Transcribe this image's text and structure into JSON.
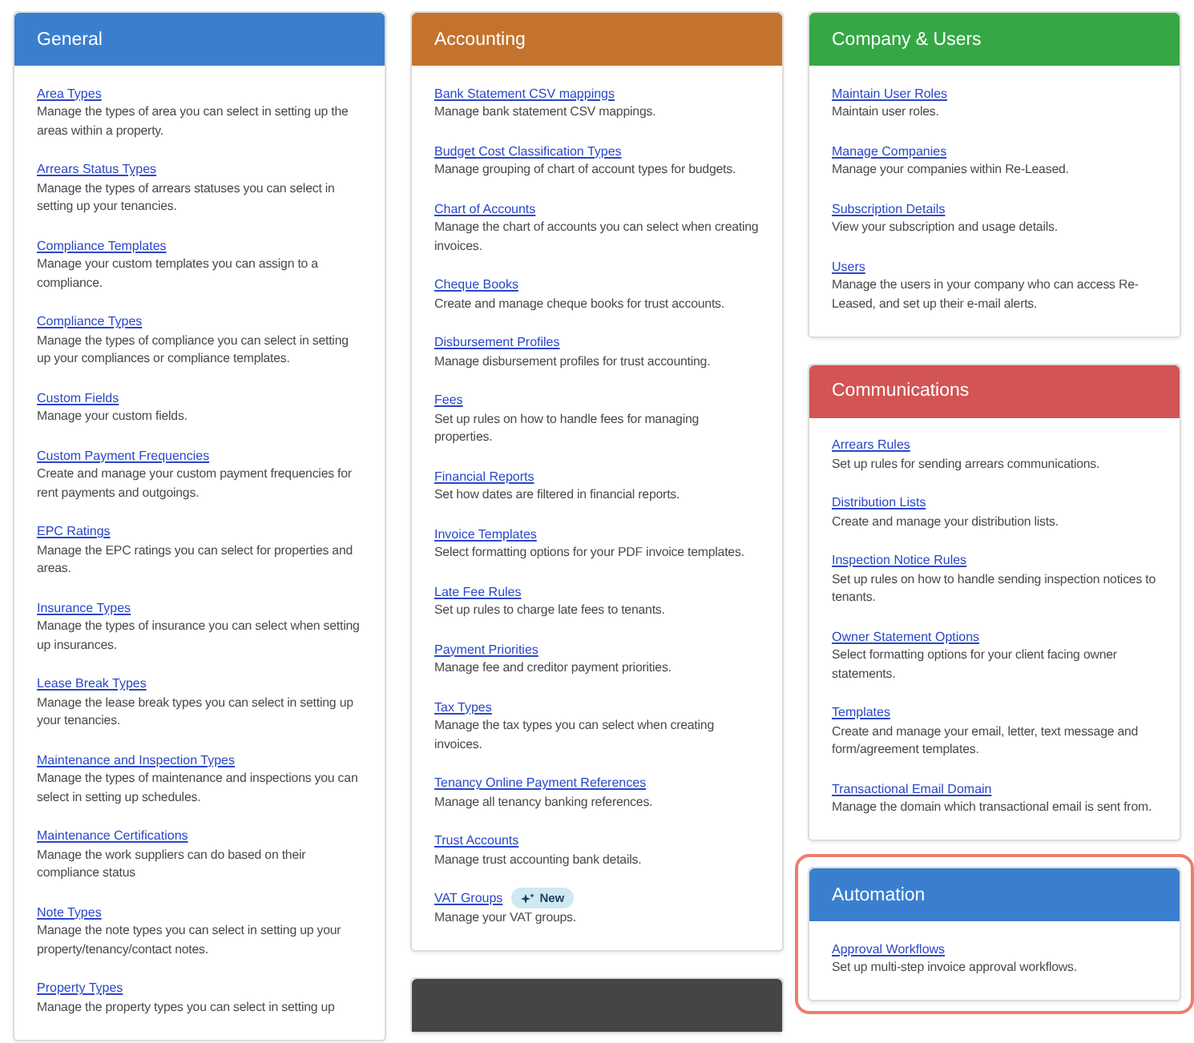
{
  "columns": [
    {
      "panels": [
        {
          "title": "General",
          "color": "#3a7fcf",
          "highlighted": false,
          "items": [
            {
              "link": "Area Types",
              "description": "Manage the types of area you can select in setting up the areas within a property."
            },
            {
              "link": "Arrears Status Types",
              "description": "Manage the types of arrears statuses you can select in setting up your tenancies."
            },
            {
              "link": "Compliance Templates",
              "description": "Manage your custom templates you can assign to a compliance."
            },
            {
              "link": "Compliance Types",
              "description": "Manage the types of compliance you can select in setting up your compliances or compliance templates."
            },
            {
              "link": "Custom Fields",
              "description": "Manage your custom fields."
            },
            {
              "link": "Custom Payment Frequencies",
              "description": "Create and manage your custom payment frequencies for rent payments and outgoings."
            },
            {
              "link": "EPC Ratings",
              "description": "Manage the EPC ratings you can select for properties and areas."
            },
            {
              "link": "Insurance Types",
              "description": "Manage the types of insurance you can select when setting up insurances."
            },
            {
              "link": "Lease Break Types",
              "description": "Manage the lease break types you can select in setting up your tenancies."
            },
            {
              "link": "Maintenance and Inspection Types",
              "description": "Manage the types of maintenance and inspections you can select in setting up schedules."
            },
            {
              "link": "Maintenance Certifications",
              "description": "Manage the work suppliers can do based on their compliance status"
            },
            {
              "link": "Note Types",
              "description": "Manage the note types you can select in setting up your property/tenancy/contact notes."
            },
            {
              "link": "Property Types",
              "description": "Manage the property types you can select in setting up"
            }
          ]
        }
      ]
    },
    {
      "panels": [
        {
          "title": "Accounting",
          "color": "#c4732e",
          "highlighted": false,
          "items": [
            {
              "link": "Bank Statement CSV mappings",
              "description": "Manage bank statement CSV mappings."
            },
            {
              "link": "Budget Cost Classification Types",
              "description": "Manage grouping of chart of account types for budgets."
            },
            {
              "link": "Chart of Accounts",
              "description": "Manage the chart of accounts you can select when creating invoices."
            },
            {
              "link": "Cheque Books",
              "description": "Create and manage cheque books for trust accounts."
            },
            {
              "link": "Disbursement Profiles",
              "description": "Manage disbursement profiles for trust accounting."
            },
            {
              "link": "Fees",
              "description": "Set up rules on how to handle fees for managing properties."
            },
            {
              "link": "Financial Reports",
              "description": "Set how dates are filtered in financial reports."
            },
            {
              "link": "Invoice Templates",
              "description": "Select formatting options for your PDF invoice templates."
            },
            {
              "link": "Late Fee Rules",
              "description": "Set up rules to charge late fees to tenants."
            },
            {
              "link": "Payment Priorities",
              "description": "Manage fee and creditor payment priorities."
            },
            {
              "link": "Tax Types",
              "description": "Manage the tax types you can select when creating invoices."
            },
            {
              "link": "Tenancy Online Payment References",
              "description": "Manage all tenancy banking references."
            },
            {
              "link": "Trust Accounts",
              "description": "Manage trust accounting bank details."
            },
            {
              "link": "VAT Groups",
              "badge": "New",
              "description": "Manage your VAT groups."
            }
          ]
        },
        {
          "color": "#454545",
          "highlighted": false
        }
      ]
    },
    {
      "panels": [
        {
          "title": "Company & Users",
          "color": "#35a845",
          "highlighted": false,
          "items": [
            {
              "link": "Maintain User Roles",
              "description": "Maintain user roles."
            },
            {
              "link": "Manage Companies",
              "description": "Manage your companies within Re-Leased."
            },
            {
              "link": "Subscription Details",
              "description": "View your subscription and usage details."
            },
            {
              "link": "Users",
              "description": "Manage the users in your company who can access Re-Leased, and set up their e-mail alerts."
            }
          ]
        },
        {
          "title": "Communications",
          "color": "#d25454",
          "highlighted": false,
          "items": [
            {
              "link": "Arrears Rules",
              "description": "Set up rules for sending arrears communications."
            },
            {
              "link": "Distribution Lists",
              "description": "Create and manage your distribution lists."
            },
            {
              "link": "Inspection Notice Rules",
              "description": "Set up rules on how to handle sending inspection notices to tenants."
            },
            {
              "link": "Owner Statement Options",
              "description": "Select formatting options for your client facing owner statements."
            },
            {
              "link": "Templates",
              "description": "Create and manage your email, letter, text message and form/agreement templates."
            },
            {
              "link": "Transactional Email Domain",
              "description": "Manage the domain which transactional email is sent from."
            }
          ]
        },
        {
          "title": "Automation",
          "color": "#3a7fcf",
          "highlighted": true,
          "items": [
            {
              "link": "Approval Workflows",
              "description": "Set up multi-step invoice approval workflows."
            }
          ]
        }
      ]
    }
  ]
}
